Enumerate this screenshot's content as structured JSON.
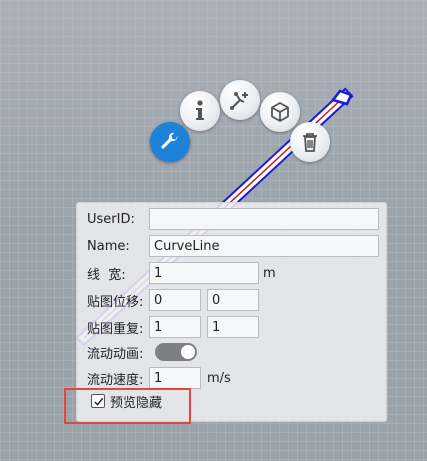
{
  "toolbar": {
    "icons": [
      "wrench-icon",
      "info-icon",
      "add-point-icon",
      "cube-icon",
      "trash-icon"
    ],
    "active_icon": "wrench-icon",
    "accent_color": "#1d82d8"
  },
  "form": {
    "userid": {
      "label": "UserID:",
      "value": ""
    },
    "name": {
      "label": "Name:",
      "value": "CurveLine"
    },
    "line_width": {
      "label": "线  宽:",
      "value": "1",
      "unit": "m"
    },
    "texture_offset": {
      "label": "贴图位移:",
      "x": "0",
      "y": "0"
    },
    "texture_repeat": {
      "label": "贴图重复:",
      "x": "1",
      "y": "1"
    },
    "flow_animation": {
      "label": "流动动画:",
      "on": true
    },
    "flow_speed": {
      "label": "流动速度:",
      "value": "1",
      "unit": "m/s"
    },
    "preview_hide": {
      "label": "预览隐藏",
      "checked": true
    }
  },
  "colors": {
    "highlight": "#e3463e",
    "line_outline": "#1a1ad8",
    "line_core": "#ffffff",
    "line_center": "#c22020"
  }
}
